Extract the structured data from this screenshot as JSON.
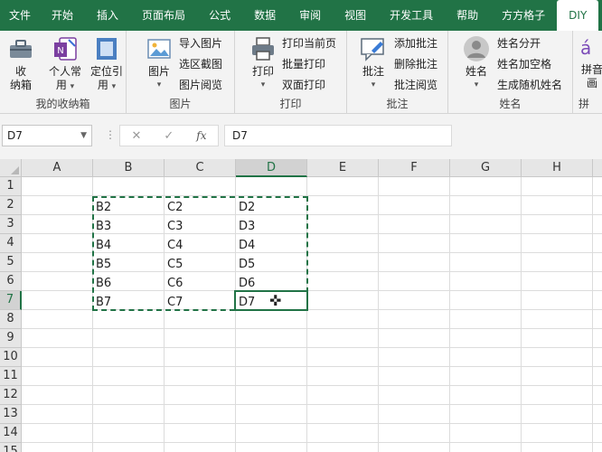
{
  "tabs": [
    "文件",
    "开始",
    "插入",
    "页面布局",
    "公式",
    "数据",
    "审阅",
    "视图",
    "开发工具",
    "帮助",
    "方方格子",
    "DIY"
  ],
  "ribbon": {
    "group1": {
      "btn1": "收",
      "btn1b": "纳箱",
      "btn2": "个人常",
      "btn2b": "用",
      "btn3": "定位引",
      "btn3b": "用",
      "label": "我的收纳箱"
    },
    "group2": {
      "big": "图片",
      "items": [
        "导入图片",
        "选区截图",
        "图片阅览"
      ],
      "label": "图片"
    },
    "group3": {
      "big": "打印",
      "items": [
        "打印当前页",
        "批量打印",
        "双面打印"
      ],
      "label": "打印"
    },
    "group4": {
      "big": "批注",
      "items": [
        "添加批注",
        "删除批注",
        "批注阅览"
      ],
      "label": "批注"
    },
    "group5": {
      "big": "姓名",
      "items": [
        "姓名分开",
        "姓名加空格",
        "生成随机姓名"
      ],
      "label": "姓名"
    },
    "group6": {
      "big1": "拼音",
      "big2": "画",
      "label": "拼"
    }
  },
  "formula": {
    "namebox": "D7",
    "fx": "fx",
    "cancel": "✕",
    "enter": "✓",
    "content": "D7"
  },
  "grid": {
    "columns": [
      "A",
      "B",
      "C",
      "D",
      "E",
      "F",
      "G",
      "H"
    ],
    "rows": [
      "1",
      "2",
      "3",
      "4",
      "5",
      "6",
      "7",
      "8",
      "9",
      "10",
      "11",
      "12",
      "13",
      "14",
      "15"
    ],
    "cells": {
      "B2": "B2",
      "C2": "C2",
      "D2": "D2",
      "B3": "B3",
      "C3": "C3",
      "D3": "D3",
      "B4": "B4",
      "C4": "C4",
      "D4": "D4",
      "B5": "B5",
      "C5": "C5",
      "D5": "D5",
      "B6": "B6",
      "C6": "C6",
      "D6": "D6",
      "B7": "B7",
      "C7": "C7",
      "D7": "D7"
    },
    "selected_column": "D",
    "selected_row": "7",
    "accent": "#217346"
  }
}
